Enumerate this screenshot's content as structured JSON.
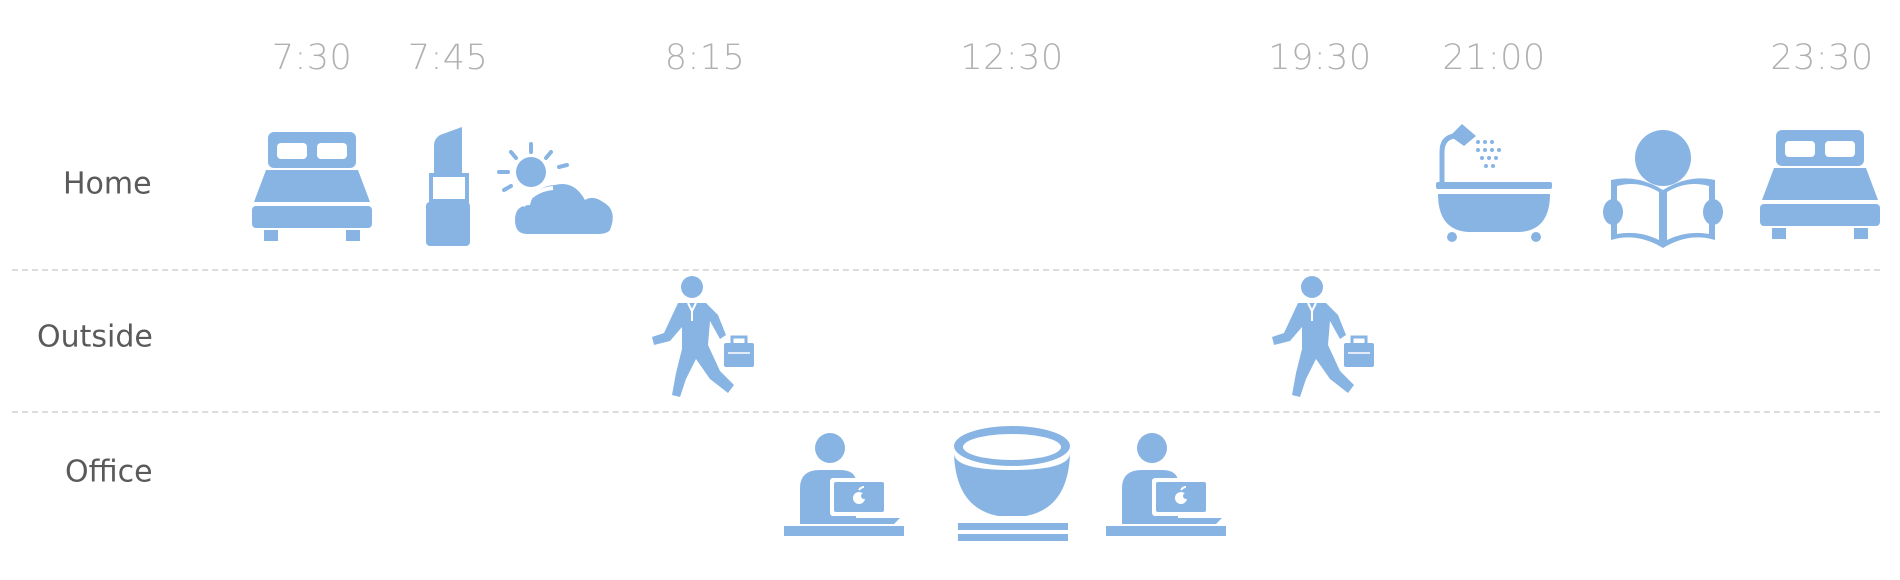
{
  "times": [
    "7:30",
    "7:45",
    "8:15",
    "12:30",
    "19:30",
    "21:00",
    "23:30"
  ],
  "rows": [
    "Home",
    "Outside",
    "Office"
  ],
  "icons": {
    "home": [
      "bed-icon",
      "lipstick-icon",
      "sun-behind-cloud-icon",
      "bathtub-icon",
      "reading-person-icon",
      "bed-icon"
    ],
    "outside": [
      "walking-businessman-icon",
      "walking-businessman-icon"
    ],
    "office": [
      "laptop-worker-icon",
      "rice-bowl-chopsticks-icon",
      "laptop-worker-icon"
    ]
  },
  "colors": {
    "icon": "#88b4e4",
    "time_text": "#b0b0b0",
    "row_text": "#5a5a5a",
    "divider": "#dcdcdc"
  }
}
